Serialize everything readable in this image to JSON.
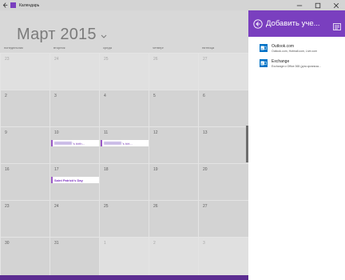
{
  "window": {
    "title": "Календарь"
  },
  "calendar": {
    "month_title": "Март 2015",
    "day_names": [
      "понедельник",
      "вторник",
      "среда",
      "четверг",
      "пятница"
    ],
    "weeks": [
      [
        "23",
        "24",
        "25",
        "26",
        "27"
      ],
      [
        "2",
        "3",
        "4",
        "5",
        "6"
      ],
      [
        "9",
        "10",
        "11",
        "12",
        "13"
      ],
      [
        "16",
        "17",
        "18",
        "19",
        "20"
      ],
      [
        "23",
        "24",
        "25",
        "26",
        "27"
      ],
      [
        "30",
        "31",
        "1",
        "2",
        "3"
      ]
    ],
    "events": {
      "birthday_1": "'s birth...",
      "birthday_2": "'s birt...",
      "st_patrick": "Saint Patrick's Day"
    }
  },
  "panel": {
    "title": "Добавить уче...",
    "accounts": [
      {
        "name": "Outlook.com",
        "desc": "Outlook.com, Hotmail.com, Live.com"
      },
      {
        "name": "Exchange",
        "desc": "Exchange и Office 365 (для организа..."
      }
    ]
  },
  "colors": {
    "accent": "#7a3fbf",
    "bottom_bar": "#5c2d91",
    "account_icon": "#0072c6"
  }
}
